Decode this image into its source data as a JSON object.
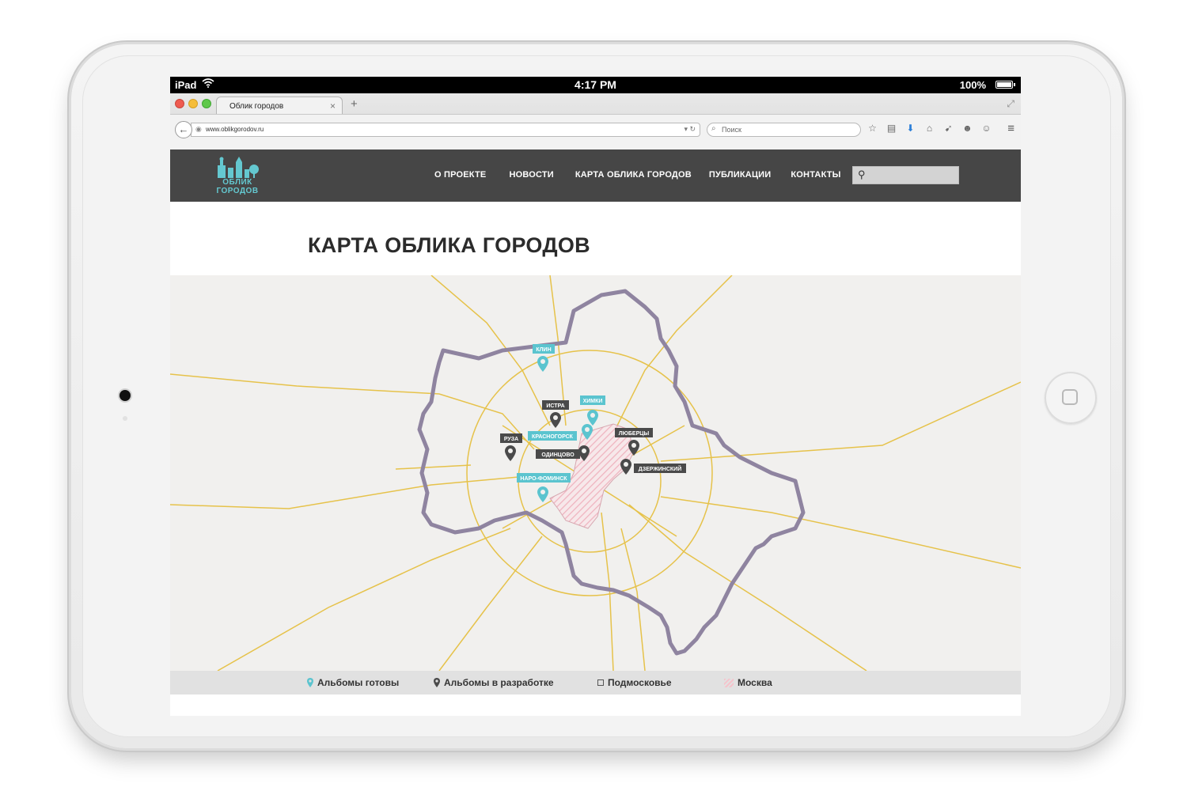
{
  "device": {
    "name": "iPad",
    "time": "4:17 PM",
    "battery": "100%"
  },
  "browser": {
    "tab_title": "Облик городов",
    "url": "www.oblikgorodov.ru",
    "search_placeholder": "Поиск",
    "new_tab_glyph": "+",
    "close_tab_glyph": "×"
  },
  "site": {
    "logo": {
      "line1": "ОБЛИК",
      "line2": "ГОРОДОВ"
    },
    "nav": [
      {
        "label": "О ПРОЕКТЕ"
      },
      {
        "label": "НОВОСТИ"
      },
      {
        "label": "КАРТА ОБЛИКА ГОРОДОВ"
      },
      {
        "label": "ПУБЛИКАЦИИ"
      },
      {
        "label": "КОНТАКТЫ"
      }
    ],
    "page_title": "КАРТА ОБЛИКА ГОРОДОВ"
  },
  "map": {
    "colors": {
      "ready": "#5bc4cf",
      "in_progress": "#4a4a4a",
      "region_border": "#8f84a0",
      "roads": "#e6c24a",
      "moscow_hatch": "#f2b8c2"
    },
    "markers": [
      {
        "name": "КЛИН",
        "status": "ready"
      },
      {
        "name": "ИСТРА",
        "status": "in_progress"
      },
      {
        "name": "ХИМКИ",
        "status": "ready"
      },
      {
        "name": "КРАСНОГОРСК",
        "status": "ready"
      },
      {
        "name": "РУЗА",
        "status": "in_progress"
      },
      {
        "name": "ЛЮБЕРЦЫ",
        "status": "in_progress"
      },
      {
        "name": "ОДИНЦОВО",
        "status": "in_progress"
      },
      {
        "name": "ДЗЕРЖИНСКИЙ",
        "status": "in_progress"
      },
      {
        "name": "НАРО-ФОМИНСК",
        "status": "ready"
      }
    ]
  },
  "legend": {
    "ready": "Альбомы готовы",
    "in_progress": "Альбомы в разработке",
    "region": "Подмосковье",
    "city": "Москва"
  },
  "icons": {
    "wifi": "wifi-icon",
    "back": "back-arrow-icon",
    "star": "star-icon",
    "download": "download-icon",
    "home": "home-icon",
    "menu": "hamburger-menu-icon",
    "search": "search-icon",
    "marker": "map-pin-icon"
  }
}
